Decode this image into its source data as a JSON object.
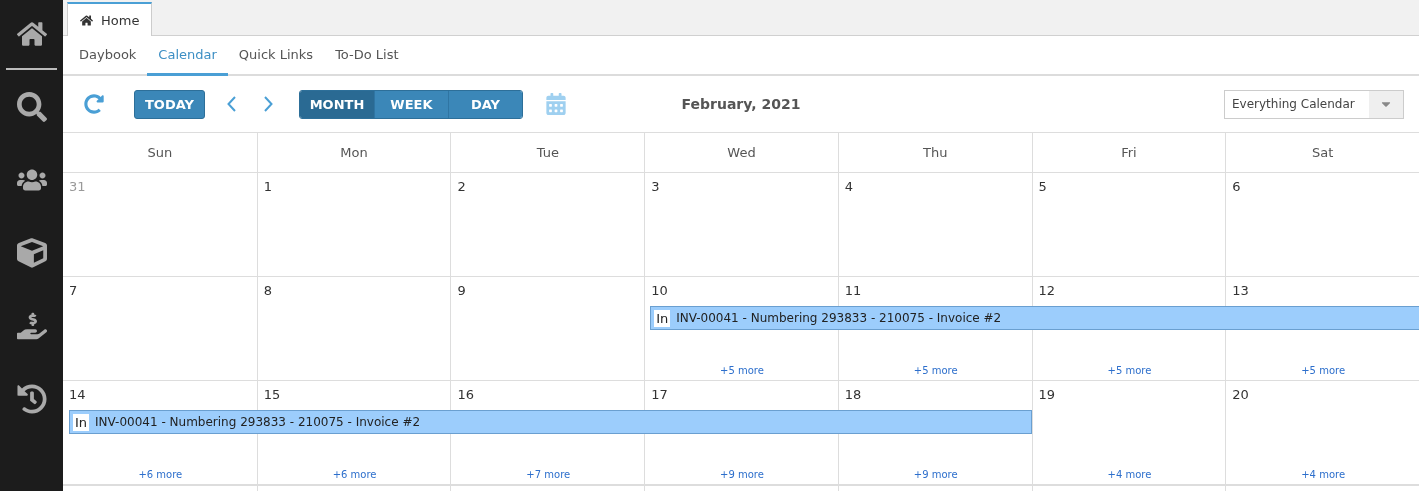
{
  "sidebar": {
    "items": [
      {
        "selected": true
      },
      {
        "selected": false
      },
      {
        "selected": false
      },
      {
        "selected": false
      },
      {
        "selected": false
      },
      {
        "selected": false
      }
    ]
  },
  "window_tabs": [
    {
      "label": "Home",
      "selected": true
    }
  ],
  "tabs": [
    {
      "label": "Daybook",
      "selected": false
    },
    {
      "label": "Calendar",
      "selected": true
    },
    {
      "label": "Quick Links",
      "selected": false
    },
    {
      "label": "To-Do List",
      "selected": false
    }
  ],
  "toolbar": {
    "today": "TODAY",
    "views": [
      {
        "label": "MONTH",
        "selected": true
      },
      {
        "label": "WEEK",
        "selected": false
      },
      {
        "label": "DAY",
        "selected": false
      }
    ],
    "title": "February, 2021",
    "calendar_select": {
      "value": "Everything Calendar"
    }
  },
  "weekdays": [
    "Sun",
    "Mon",
    "Tue",
    "Wed",
    "Thu",
    "Fri",
    "Sat"
  ],
  "weeks": [
    {
      "days": [
        {
          "date": "31",
          "other_month": true
        },
        {
          "date": "1",
          "other_month": false
        },
        {
          "date": "2",
          "other_month": false
        },
        {
          "date": "3",
          "other_month": false
        },
        {
          "date": "4",
          "other_month": false
        },
        {
          "date": "5",
          "other_month": false
        },
        {
          "date": "6",
          "other_month": false
        }
      ]
    },
    {
      "event": {
        "badge": "In",
        "label": "INV-00041 - Numbering 293833 - 210075 - Invoice #2"
      },
      "days": [
        {
          "date": "7",
          "other_month": false,
          "in_event": false
        },
        {
          "date": "8",
          "other_month": false,
          "in_event": false
        },
        {
          "date": "9",
          "other_month": false,
          "in_event": false
        },
        {
          "date": "10",
          "other_month": false,
          "in_event": true,
          "more": "+5 more"
        },
        {
          "date": "11",
          "other_month": false,
          "in_event": true,
          "more": "+5 more"
        },
        {
          "date": "12",
          "other_month": false,
          "in_event": true,
          "more": "+5 more"
        },
        {
          "date": "13",
          "other_month": false,
          "in_event": true,
          "more": "+5 more"
        }
      ]
    },
    {
      "event": {
        "badge": "In",
        "label": "INV-00041 - Numbering 293833 - 210075 - Invoice #2"
      },
      "days": [
        {
          "date": "14",
          "other_month": false,
          "in_event": true,
          "more": "+6 more"
        },
        {
          "date": "15",
          "other_month": false,
          "in_event": true,
          "more": "+6 more"
        },
        {
          "date": "16",
          "other_month": false,
          "in_event": true,
          "more": "+7 more"
        },
        {
          "date": "17",
          "other_month": false,
          "in_event": true,
          "more": "+9 more"
        },
        {
          "date": "18",
          "other_month": false,
          "in_event": true,
          "more": "+9 more"
        },
        {
          "date": "19",
          "other_month": false,
          "in_event": false,
          "more": "+4 more"
        },
        {
          "date": "20",
          "other_month": false,
          "in_event": false,
          "more": "+4 more"
        }
      ]
    }
  ]
}
